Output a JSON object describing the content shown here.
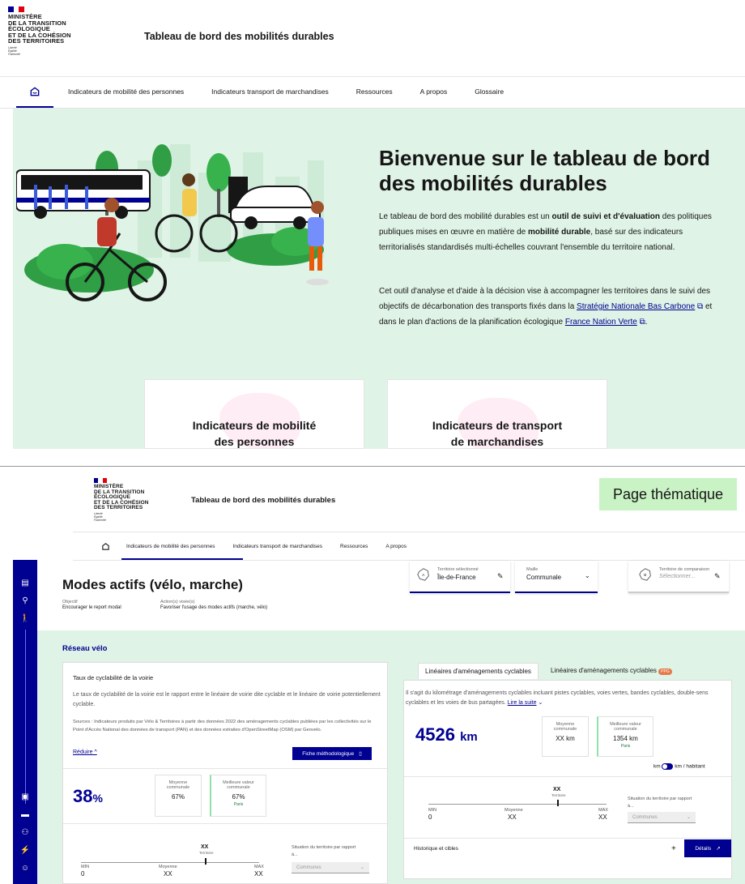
{
  "header": {
    "ministry_lines": [
      "MINISTÈRE",
      "DE LA TRANSITION",
      "ÉCOLOGIQUE",
      "ET DE LA COHÉSION",
      "DES TERRITOIRES"
    ],
    "motto_lines": [
      "Liberté",
      "Égalité",
      "Fraternité"
    ],
    "site_title": "Tableau de bord des mobilités durables"
  },
  "nav": {
    "items": [
      "Indicateurs de mobilité des personnes",
      "Indicateurs transport de marchandises",
      "Ressources",
      "A propos",
      "Glossaire"
    ]
  },
  "hero": {
    "title_line1": "Bienvenue sur le tableau de bord",
    "title_line2": "des mobilités durables",
    "p1_a": "Le tableau de bord des mobilité durables est un ",
    "p1_b": "outil de suivi et d'évaluation",
    "p1_c": " des politiques publiques mises en œuvre en matière de ",
    "p1_d": "mobilité durable",
    "p1_e": ", basé sur des indicateurs territorialisés standardisés multi-échelles couvrant l'ensemble du territoire national.",
    "p2_a": "Cet outil d'analyse et d'aide à la décision vise à accompagner les territoires dans le suivi des objectifs de décarbonation des transports fixés dans la ",
    "p2_link1": "Stratégie Nationale Bas Carbone",
    "p2_b": " et dans le plan d'actions de la planification écologique ",
    "p2_link2": "France Nation Verte",
    "p2_c": "."
  },
  "cards": {
    "people_line1": "Indicateurs de mobilité",
    "people_line2": "des personnes",
    "freight_line1": "Indicateurs de transport",
    "freight_line2": "de marchandises"
  },
  "page2": {
    "badge": "Page thématique",
    "nav_items": [
      "Indicateurs de mobilité des personnes",
      "Indicateurs transport de marchandises",
      "Ressources",
      "A propos"
    ],
    "theme_title": "Modes actifs (vélo, marche)",
    "objective_label": "Objectif",
    "objective_value": "Encourager le report modal",
    "actions_label": "Action(s) visée(s)",
    "actions_value": "Favoriser l'usage des modes actifs (marche, vélo)",
    "territory_label": "Territoire sélectionné",
    "territory_value": "Île-de-France",
    "maille_label": "Maille",
    "maille_value": "Communale",
    "comparison_label": "Territoire de comparaison",
    "comparison_placeholder": "Sélectionner...",
    "section_title": "Réseau vélo",
    "left_panel": {
      "title": "Taux de cyclabilité de la voirie",
      "desc": "Le taux de cyclabilité de la voirie est le rapport entre le linéaire de voirie dite cyclable et le linéaire de voirie potentiellement cyclable.",
      "sources": "Sources : Indicateurs produits par Vélo & Territoires à partir des données 2022 des aménagements cyclables publiées par les collectivités sur le Point d'Accès National des données de transport (PAN) et des données extraites d'OpenStreetMap (OSM) par Geovelo.",
      "reduce": "Réduire",
      "method_button": "Fiche méthodologique",
      "value": "38",
      "unit": "%",
      "avg_label": "Moyenne communale",
      "avg_value": "67%",
      "best_label": "Meilleure valeur communale",
      "best_value": "67%",
      "best_place": "Paris",
      "gauge_top": "XX",
      "gauge_top_label": "Territoire",
      "min_label": "MIN",
      "min_value": "0",
      "mean_label": "Moyenne",
      "mean_value": "XX",
      "max_label": "MAX",
      "max_value": "XX",
      "situation_label": "Situation du territoire par rapport à...",
      "situation_select": "Communes"
    },
    "right_panel": {
      "tab1": "Linéaires d'aménagements cyclables",
      "tab2": "Linéaires d'aménagements cyclables",
      "tab2_badge": "PPG",
      "desc": "Il s'agit du kilométrage d'aménagements cyclables incluant pistes cyclables, voies vertes, bandes cyclables, double-sens cyclables et les voies de bus partagées.",
      "read_more": "Lire la suite",
      "value": "4526",
      "unit": "km",
      "avg_label": "Moyenne communale",
      "avg_value": "XX km",
      "best_label": "Meilleure valeur communale",
      "best_value": "1354 km",
      "best_place": "Paris",
      "toggle_left": "km",
      "toggle_right": "km / habitant",
      "gauge_top": "XX",
      "gauge_top_label": "Territoire",
      "min_label": "MIN",
      "min_value": "0",
      "mean_label": "Moyenne",
      "mean_value": "XX",
      "max_label": "MAX",
      "max_value": "XX",
      "situation_label": "Situation du territoire par rapport à...",
      "situation_select": "Communes",
      "history": "Historique et cibles",
      "plus": "+",
      "details": "Détails"
    }
  },
  "colors": {
    "primary": "#000091",
    "hero_bg": "#dff3e6",
    "badge_bg": "#c9f3c4",
    "marianne_red": "#e1000f"
  }
}
